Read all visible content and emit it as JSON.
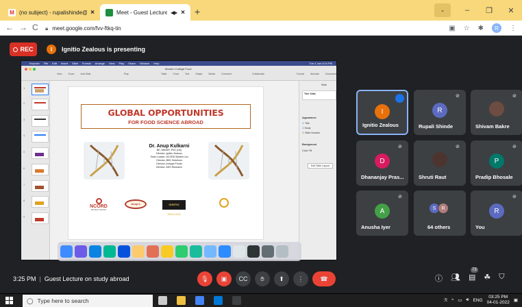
{
  "browser": {
    "tabs": [
      {
        "title": "(no subject) - rupalishinde@mo",
        "icon_color": "#d93025"
      },
      {
        "title": "Meet - Guest Lecture on stu",
        "icon_color": "#1e8e3e"
      }
    ],
    "new_tab": "+",
    "url": "meet.google.com/fvv-ftkq-tin",
    "profile_initial": "R"
  },
  "meet": {
    "rec_label": "REC",
    "presenter_initial": "I",
    "presenting_text": "Ignitio Zealous is presenting",
    "time": "3:25 PM",
    "meeting_title": "Guest Lecture on study abroad",
    "participant_count": "73"
  },
  "slide": {
    "app_doc_title": "Modern College Food",
    "title_line1": "GLOBAL OPPORTUNITIES",
    "title_line2": "FOR FOOD SCIENCE ABROAD",
    "speaker_name": "Dr. Anup Kulkarni",
    "speaker_lines": [
      "BE, MtechR, PhD (UK)",
      "Director, Ignitio Zealous",
      "Team Leader, NCORD Biotech Ltd",
      "Director, BKD Solutions",
      "Director, Anirppa Foods",
      "Director, ADS Research"
    ],
    "logo_ncord": "NCORD",
    "logo_ncord_sub": "BIOTECH LIMITED",
    "logo_anup": "Anup's",
    "logo_ignitio": "IGNITIO ZEALOUS",
    "inspector": {
      "slide_layout": "Title Slide",
      "appearance": "Appearance",
      "title": "Title",
      "body": "Body",
      "slide_number": "Slide Number",
      "background": "Background",
      "color_fill": "Color Fill",
      "edit_layout": "Edit Slide Layout"
    }
  },
  "participants": [
    {
      "name": "Ignitio Zealous",
      "initial": "I",
      "color": "#e8710a",
      "talking": true
    },
    {
      "name": "Rupali Shinde",
      "initial": "R",
      "color": "#5c6bc0"
    },
    {
      "name": "Shivam Bakre",
      "initial": "",
      "color": "#6d4c41"
    },
    {
      "name": "Dhananjay Pras...",
      "initial": "D",
      "color": "#d81b60"
    },
    {
      "name": "Shruti Raut",
      "initial": "",
      "color": "#4e342e"
    },
    {
      "name": "Pradip Bhosale",
      "initial": "P",
      "color": "#00796b"
    },
    {
      "name": "Anusha Iyer",
      "initial": "A",
      "color": "#43a047"
    },
    {
      "name": "64 others",
      "initial": "S",
      "initial2": "R",
      "color": "#5c6bc0",
      "color2": "#b07c7c"
    },
    {
      "name": "You",
      "initial": "R",
      "color": "#5c6bc0"
    }
  ],
  "taskbar": {
    "search_placeholder": "Type here to search",
    "lang": "ENG",
    "time": "03:25 PM",
    "date": "04-01-2022"
  }
}
